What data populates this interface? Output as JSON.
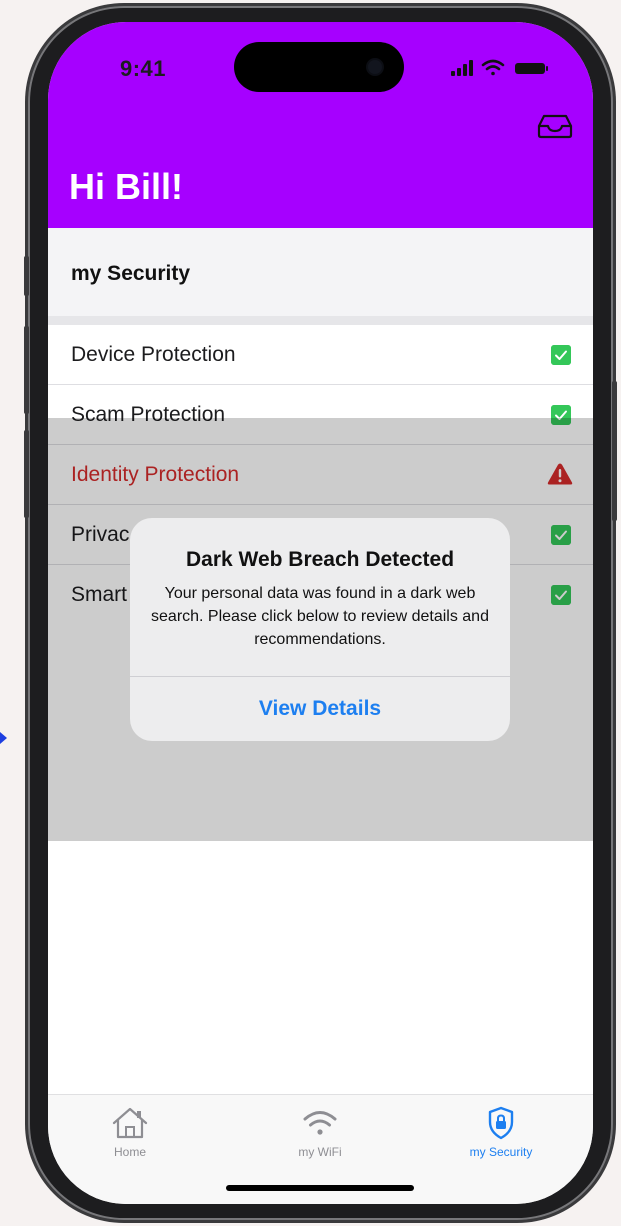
{
  "status_bar": {
    "time": "9:41"
  },
  "header": {
    "greeting": "Hi Bill!",
    "inbox_icon": "inbox-icon"
  },
  "section": {
    "title": "my Security"
  },
  "list": {
    "items": [
      {
        "label": "Device Protection",
        "status": "ok"
      },
      {
        "label": "Scam Protection",
        "status": "ok"
      },
      {
        "label": "Identity Protection",
        "status": "alert"
      },
      {
        "label": "Privac",
        "status": "ok"
      },
      {
        "label": "Smart",
        "status": "ok"
      }
    ]
  },
  "alert": {
    "title": "Dark Web Breach Detected",
    "message": "Your personal data was found in a dark web search.  Please click below to review details and recommendations.",
    "action": "View Details"
  },
  "tabbar": {
    "tabs": [
      {
        "label": "Home",
        "icon": "home-icon",
        "active": false
      },
      {
        "label": "my WiFi",
        "icon": "wifi-icon",
        "active": false
      },
      {
        "label": "my Security",
        "icon": "shield-lock-icon",
        "active": true
      }
    ]
  },
  "colors": {
    "header": "#a600ff",
    "accent": "#1d7ff0",
    "ok": "#34c759",
    "alert": "#d62b2b"
  }
}
